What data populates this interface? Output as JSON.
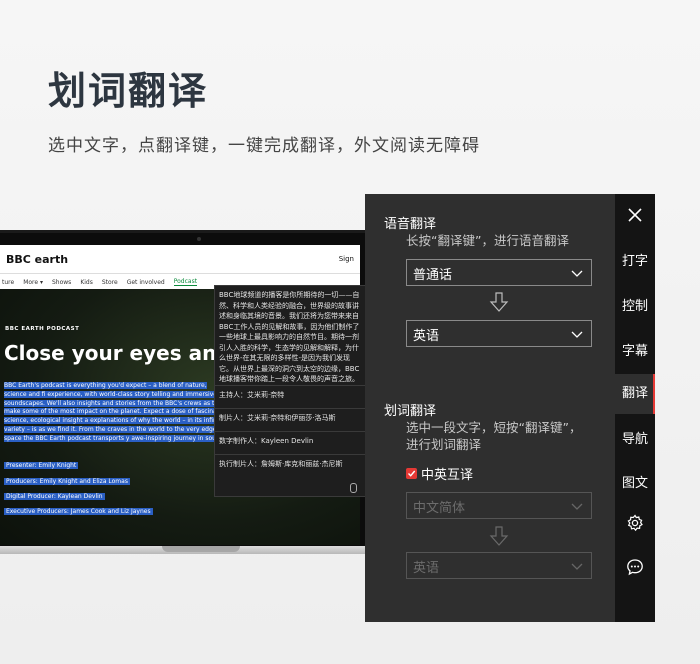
{
  "heading": "划词翻译",
  "subheading": "选中文字，点翻译键，一键完成翻译，外文阅读无障碍",
  "colors": {
    "accent": "#e53935",
    "panel_bg": "#2f2f2f",
    "sidebar_bg": "#141414",
    "highlight": "#2a5fc4"
  },
  "laptop": {
    "site_logo": "BBC earth",
    "site_nav": [
      "ture",
      "More ▾",
      "Shows",
      "Kids",
      "Store",
      "Get involved",
      "Podcast"
    ],
    "signin": "Sign",
    "kicker": "BBC EARTH PODCAST",
    "title": "Close your eyes and ope",
    "description": "BBC Earth's podcast is everything you'd expect – a blend of nature, science and fi experience, with world-class story telling and immersive soundscapes. We'll also insights and stories from the BBC's crews as they make some of the most impact on the planet. Expect a dose of fascinating science, ecological insight a explanations of why the world – in its infinite variety – is as we find it. From the craves in the world to the very edge of space the BBC Earth podcast transports y awe-inspiring journey in sound.",
    "credits": [
      "Presenter: Emily Knight",
      "Producers: Emily Knight and Eliza Lomas",
      "Digital Producer: Kaylean Devlin",
      "Executive Producers: James Cook and Liz Jaynes"
    ],
    "popup": {
      "text": "BBC地球频道的播客是你所期待的一切——自然、科学和人类经验的融合，世界级的故事讲述和身临其境的音景。我们还将为您带来来自BBC工作人员的见解和故事，因为他们制作了一些地球上最具影响力的自然节目。期待一剂引人入胜的科学，生态学的见解和解释，为什么世界-在其无限的多样性-是因为我们发现它。从世界上最深的洞穴到太空的边缘，BBC地球播客带你踏上一段令人敬畏的声音之旅。",
      "rows": [
        "主持人：艾米莉·奈特",
        "制片人：艾米莉·奈特和伊丽莎·洛马斯",
        "数字制作人：Kayleen Devlin",
        "执行制片人：詹姆斯·库克和丽兹·杰尼斯"
      ]
    }
  },
  "panel": {
    "voice": {
      "title": "语音翻译",
      "hint": "长按“翻译键”，进行语音翻译",
      "source": "普通话",
      "target": "英语"
    },
    "text": {
      "title": "划词翻译",
      "hint_line1": "选中一段文字，短按“翻译键”，",
      "hint_line2": "进行划词翻译",
      "checkbox_label": "中英互译",
      "checkbox_checked": true,
      "source": "中文简体",
      "target": "英语"
    }
  },
  "sidebar": {
    "close_icon": "close-icon",
    "items": [
      "打字",
      "控制",
      "字幕",
      "翻译",
      "导航",
      "图文"
    ],
    "active": "翻译",
    "settings_icon": "gear-icon",
    "chat_icon": "chat-icon"
  }
}
